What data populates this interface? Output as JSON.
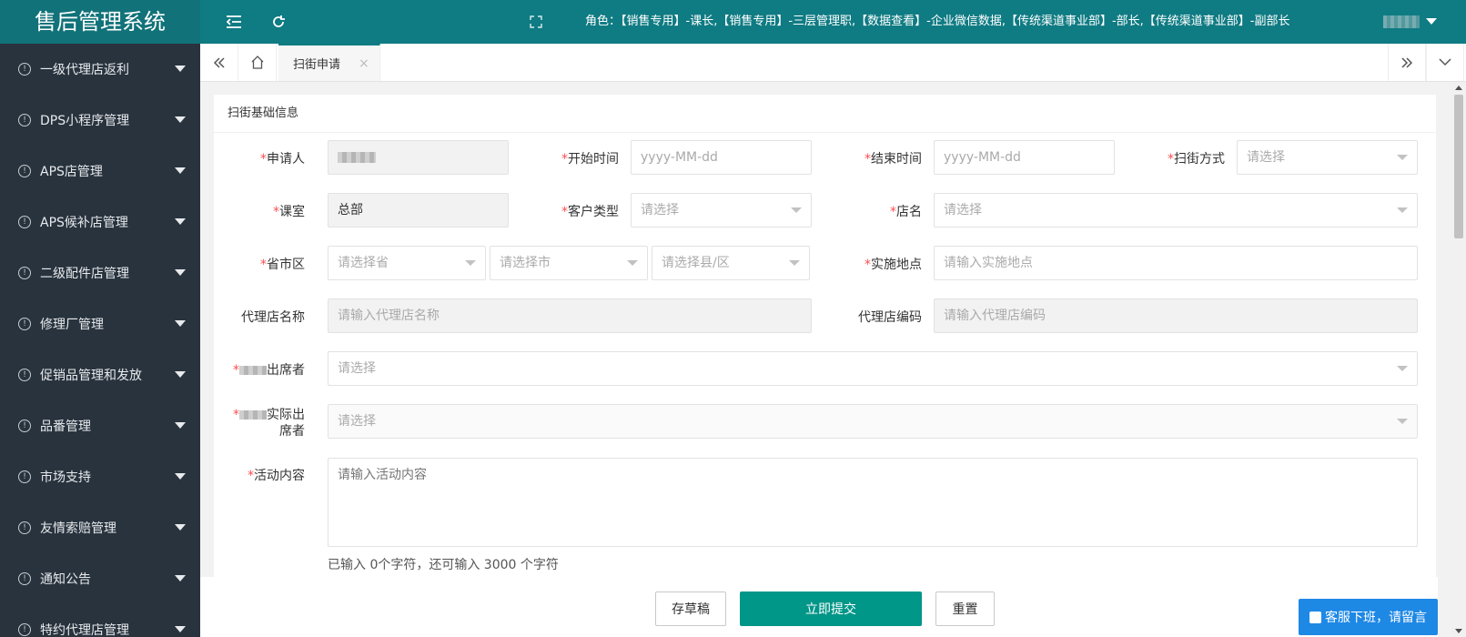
{
  "header": {
    "title": "售后管理系统",
    "roles": "角色：【销售专用】-课长,【销售专用】-三层管理职,【数据查看】-企业微信数据,【传统渠道事业部】-部长,【传统渠道事业部】-副部长"
  },
  "sidebar": {
    "items": [
      {
        "label": "一级代理店返利"
      },
      {
        "label": "DPS小程序管理"
      },
      {
        "label": "APS店管理"
      },
      {
        "label": "APS候补店管理"
      },
      {
        "label": "二级配件店管理"
      },
      {
        "label": "修理厂管理"
      },
      {
        "label": "促销品管理和发放"
      },
      {
        "label": "品番管理"
      },
      {
        "label": "市场支持"
      },
      {
        "label": "友情索赔管理"
      },
      {
        "label": "通知公告"
      },
      {
        "label": "特约代理店管理"
      }
    ]
  },
  "tabs": {
    "active": "扫街申请",
    "close": "×"
  },
  "form": {
    "section_title": "扫街基础信息",
    "labels": {
      "applicant": "申请人",
      "start_time": "开始时间",
      "end_time": "结束时间",
      "sweep_method": "扫街方式",
      "section": "课室",
      "customer_type": "客户类型",
      "store_name": "店名",
      "region": "省市区",
      "location": "实施地点",
      "agent_name": "代理店名称",
      "agent_code": "代理店编码",
      "attendees": "出席者",
      "actual_attendees_a": "实际出",
      "actual_attendees_b": "席者",
      "activity": "活动内容"
    },
    "values": {
      "section": "总部"
    },
    "placeholders": {
      "start_time": "yyyy-MM-dd",
      "end_time": "yyyy-MM-dd",
      "select": "请选择",
      "province": "请选择省",
      "city": "请选择市",
      "county": "请选择县/区",
      "location": "请输入实施地点",
      "agent_name": "请输入代理店名称",
      "agent_code": "请输入代理店编码",
      "activity": "请输入活动内容"
    },
    "counter": "已输入 0个字符，还可输入 3000 个字符"
  },
  "buttons": {
    "draft": "存草稿",
    "submit": "立即提交",
    "reset": "重置"
  },
  "chat": {
    "label": "客服下班，请留言"
  }
}
